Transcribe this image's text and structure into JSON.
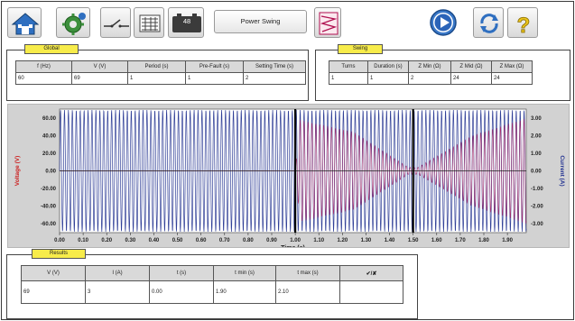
{
  "toolbar": {
    "battery_value": "48",
    "mode_label": "Power Swing",
    "icons": [
      "home-icon",
      "settings-gear-icon",
      "disconnect-switch-icon",
      "meter-icon",
      "battery-icon",
      "relay-curve-icon",
      "play-icon",
      "refresh-icon",
      "help-icon"
    ]
  },
  "global": {
    "tag": "Global",
    "headers": [
      "f (Hz)",
      "V (V)",
      "Period (s)",
      "Pre-Fault (s)",
      "Setting Time (s)"
    ],
    "values": [
      "60",
      "69",
      "1",
      "1",
      "2"
    ]
  },
  "swing": {
    "tag": "Swing",
    "headers": [
      "Turns",
      "Duration (s)",
      "Z Min  (Ω)",
      "Z Mid  (Ω)",
      "Z Max  (Ω)"
    ],
    "values": [
      "1",
      "1",
      "2",
      "24",
      "24"
    ]
  },
  "results": {
    "tag": "Results",
    "headers": [
      "V (V)",
      "I (A)",
      "t (s)",
      "t min (s)",
      "t max (s)",
      "✔/✘"
    ],
    "values": [
      "69",
      "3",
      "0.00",
      "1.90",
      "2.10",
      ""
    ]
  },
  "chart_data": {
    "type": "line",
    "xlabel": "Time (s)",
    "ylabel_left": "Voltage (V)",
    "ylabel_right": "Current (A)",
    "x_ticks": [
      "0.00",
      "0.10",
      "0.20",
      "0.30",
      "0.40",
      "0.50",
      "0.60",
      "0.70",
      "0.80",
      "0.90",
      "1.00",
      "1.10",
      "1.20",
      "1.30",
      "1.40",
      "1.50",
      "1.60",
      "1.70",
      "1.80",
      "1.90"
    ],
    "y_left_ticks": [
      "60.00",
      "40.00",
      "20.00",
      "0.00",
      "-20.00",
      "-40.00",
      "-60.00"
    ],
    "y_right_ticks": [
      "3.00",
      "2.00",
      "1.00",
      "0.00",
      "-1.00",
      "-2.00",
      "-3.00"
    ],
    "xlim": [
      0,
      1.98
    ],
    "y_left_lim": [
      -70,
      70
    ],
    "y_right_lim": [
      -3.5,
      3.5
    ],
    "grid": false,
    "series": [
      {
        "axis": "left",
        "color": "#1a2a8c",
        "frequency_hz": 60,
        "amplitude_start": 69,
        "amplitude_end": 69
      },
      {
        "axis": "right",
        "color": "#b01050",
        "frequency_hz": 60,
        "amplitude_start": 0,
        "amplitude_end": 3,
        "envelope_points": [
          [
            0.0,
            0
          ],
          [
            1.0,
            0
          ],
          [
            1.02,
            2.9
          ],
          [
            1.25,
            2.2
          ],
          [
            1.48,
            0.2
          ],
          [
            1.52,
            0.2
          ],
          [
            1.75,
            2.0
          ],
          [
            1.98,
            3.0
          ]
        ]
      }
    ],
    "markers_x": [
      1.0,
      1.5
    ],
    "colors": {
      "voltage": "#1a2a8c",
      "current": "#b01050",
      "voltage_label": "#cc2020",
      "current_label": "#203090"
    }
  }
}
